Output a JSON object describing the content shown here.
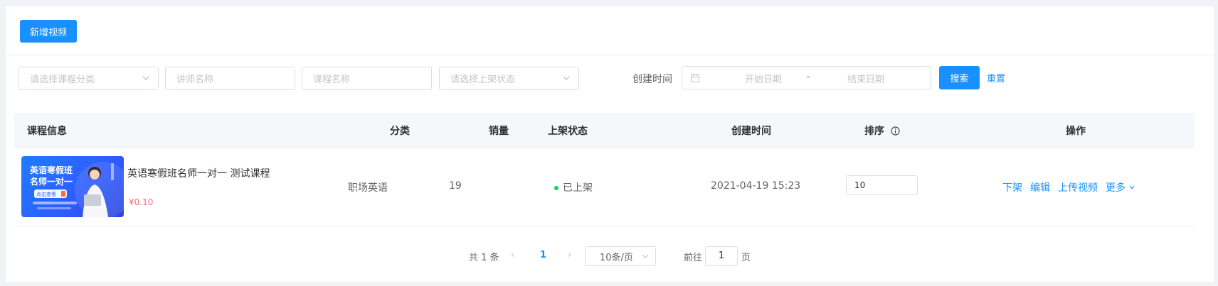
{
  "toolbar": {
    "add_label": "新增视频"
  },
  "filters": {
    "category_placeholder": "请选择课程分类",
    "teacher_placeholder": "讲师名称",
    "course_placeholder": "课程名称",
    "status_placeholder": "请选择上架状态",
    "created_label": "创建时间",
    "start_placeholder": "开始日期",
    "separator": "-",
    "end_placeholder": "结束日期",
    "search_label": "搜索",
    "reset_label": "重置"
  },
  "table": {
    "headers": {
      "info": "课程信息",
      "category": "分类",
      "sales": "销量",
      "status": "上架状态",
      "created": "创建时间",
      "sort": "排序",
      "ops": "操作"
    },
    "rows": [
      {
        "thumb_title_1": "英语寒假班",
        "thumb_title_2": "名师一对一",
        "thumb_button": "点击查看",
        "name": "英语寒假班名师一对一 测试课程",
        "price": "¥0.10",
        "category": "职场英语",
        "sales": "19",
        "status": "已上架",
        "created": "2021-04-19 15:23",
        "sort": "10",
        "ops": {
          "off": "下架",
          "edit": "编辑",
          "upload": "上传视频",
          "more": "更多"
        }
      }
    ]
  },
  "pagination": {
    "total": "共 1 条",
    "current": "1",
    "page_size": "10条/页",
    "goto_label": "前往",
    "goto_value": "1",
    "goto_unit": "页"
  },
  "colors": {
    "primary": "#1890ff",
    "price": "#f56c6c",
    "status_dot": "#13ce66"
  }
}
